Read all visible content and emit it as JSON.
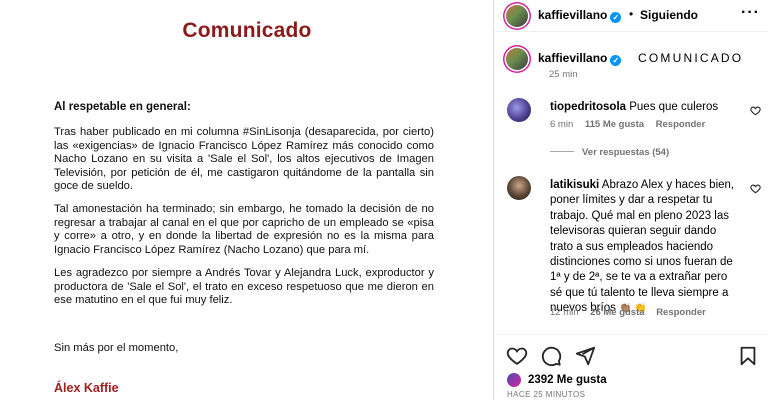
{
  "post_image": {
    "title": "Comunicado",
    "greeting": "Al respetable en general:",
    "paragraphs": [
      "Tras haber publicado en mi columna #SinLisonja (desaparecida, por cierto) las «exigencias» de Ignacio Francisco López Ramírez más conocido como Nacho Lozano en su visita a 'Sale el Sol', los altos ejecutivos de Imagen Televisión, por petición de él, me castigaron quitándome de la pantalla sin goce de sueldo.",
      "Tal amonestación ha terminado; sin embargo, he tomado la decisión de no regresar a trabajar al canal en el que por capricho de un empleado se «pisa y corre» a otro, y en donde la libertad de expresión no es la misma para Ignacio Francisco López Ramírez (Nacho Lozano) que para mí.",
      "Les agradezco por siempre a Andrés Tovar y Alejandra Luck, exproductor y productora de 'Sale el Sol', el trato en exceso respetuoso que me dieron en ese matutino en el que fui muy feliz."
    ],
    "closing": "Sin más por el momento,",
    "signature": "Álex Kaffie"
  },
  "header": {
    "username": "kaffievillano",
    "separator": "•",
    "follow_label": "Siguiendo",
    "more_icon": "more-horizontal-icon"
  },
  "caption": {
    "username": "kaffievillano",
    "text": "COMUNICADO",
    "time": "25 min"
  },
  "comments": [
    {
      "username": "tiopedritosola",
      "text": "Pues que culeros",
      "time": "6 min",
      "likes": "115 Me gusta",
      "reply_label": "Responder",
      "view_replies": "Ver respuestas (54)"
    },
    {
      "username": "latikisuki",
      "text": "Abrazo Alex y haces bien, poner límites y dar a respetar tu trabajo. Qué mal en pleno 2023 las televisoras quieran seguir dando trato a sus empleados haciendo distinciones como si unos fueran de 1ª y de 2ª, se te va a extrañar pero sé que tú talento te lleva siempre a nuevos bríos",
      "emojis": "👏🏽 👏",
      "time": "12 min",
      "likes": "26 Me gusta",
      "reply_label": "Responder"
    }
  ],
  "actions": {
    "likes": "2392 Me gusta",
    "time_ago": "HACE 25 MINUTOS"
  },
  "colors": {
    "title_red": "#8b1a1a",
    "signature_red": "#9e2020",
    "verified_blue": "#0095f6",
    "meta_gray": "#737373"
  }
}
